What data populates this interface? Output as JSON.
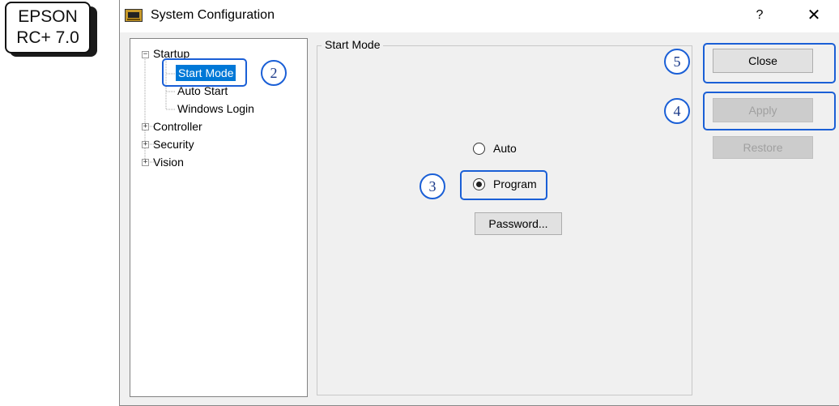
{
  "badge": {
    "line1": "EPSON",
    "line2": "RC+ 7.0"
  },
  "window": {
    "title": "System Configuration",
    "help": "?",
    "close_glyph": "✕",
    "icon": "controller-icon"
  },
  "tree": {
    "items": [
      {
        "label": "Startup",
        "expander": "−"
      },
      {
        "label": "Start Mode",
        "selected": true
      },
      {
        "label": "Auto Start"
      },
      {
        "label": "Windows Login"
      },
      {
        "label": "Controller",
        "expander": "+"
      },
      {
        "label": "Security",
        "expander": "+"
      },
      {
        "label": "Vision",
        "expander": "+"
      }
    ]
  },
  "group": {
    "title": "Start Mode",
    "radio_auto": "Auto",
    "radio_program": "Program",
    "selected": "Program",
    "password_label": "Password..."
  },
  "buttons": {
    "close": "Close",
    "apply": "Apply",
    "restore": "Restore"
  },
  "callouts": [
    "2",
    "3",
    "4",
    "5"
  ],
  "colors": {
    "callout": "#1a5fd6",
    "selection": "#0078d7"
  }
}
